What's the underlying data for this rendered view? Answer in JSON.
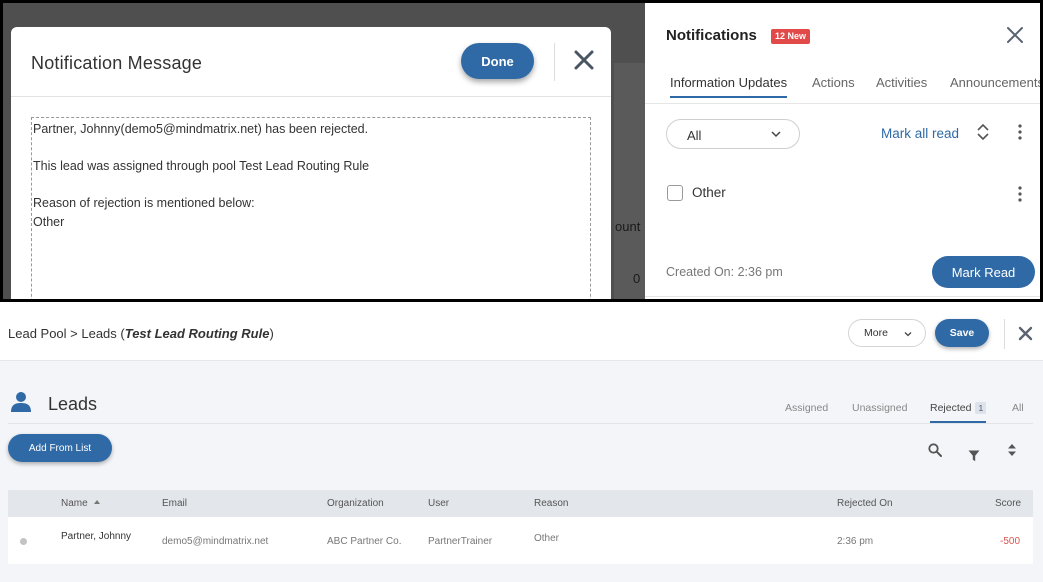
{
  "background": {
    "count_fragment": "ount",
    "zero_fragment": "0"
  },
  "modal": {
    "title": "Notification Message",
    "done_label": "Done",
    "message_line1": "Partner, Johnny(demo5@mindmatrix.net) has been rejected.",
    "message_line2": "This lead was assigned through pool Test Lead Routing Rule",
    "message_line3": "Reason of rejection is mentioned below:",
    "message_line4": "Other"
  },
  "notifications": {
    "title": "Notifications",
    "badge": "12 New",
    "tabs": [
      "Information Updates",
      "Actions",
      "Activities",
      "Announcements"
    ],
    "active_tab": "Information Updates",
    "filter_value": "All",
    "mark_all_label": "Mark all read",
    "item_label": "Other",
    "created_on": "Created On: 2:36 pm",
    "mark_read_label": "Mark Read"
  },
  "lead_pool": {
    "breadcrumb_pool": "Lead Pool > Leads (",
    "breadcrumb_rule": "Test Lead Routing Rule",
    "breadcrumb_close": ")",
    "more_label": "More",
    "save_label": "Save",
    "section_title": "Leads",
    "tabs": {
      "assigned": "Assigned",
      "unassigned": "Unassigned",
      "rejected": "Rejected",
      "rejected_count": "1",
      "all": "All"
    },
    "add_from_list_label": "Add From List",
    "columns": {
      "name": "Name",
      "email": "Email",
      "organization": "Organization",
      "user": "User",
      "reason": "Reason",
      "rejected_on": "Rejected On",
      "score": "Score"
    },
    "rows": [
      {
        "name": "Partner, Johnny",
        "email": "demo5@mindmatrix.net",
        "organization": "ABC Partner Co.",
        "user": "PartnerTrainer",
        "reason": "Other",
        "rejected_on": "2:36 pm",
        "score": "-500"
      }
    ]
  },
  "colors": {
    "accent": "#2f6aa6",
    "badge": "#e24a4a",
    "negative_score": "#d9534f"
  },
  "icons": [
    "close-icon",
    "chevron-down-icon",
    "sort-icon",
    "more-vertical-icon",
    "user-icon",
    "search-icon",
    "filter-icon",
    "sort-ascending-icon"
  ]
}
